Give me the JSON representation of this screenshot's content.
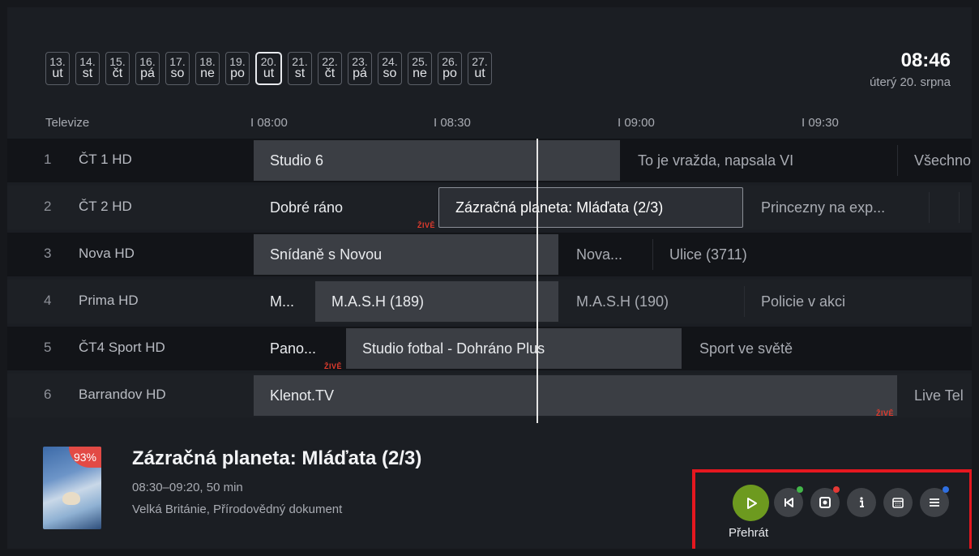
{
  "dates": [
    {
      "num": "13.",
      "day": "ut"
    },
    {
      "num": "14.",
      "day": "st"
    },
    {
      "num": "15.",
      "day": "čt"
    },
    {
      "num": "16.",
      "day": "pá"
    },
    {
      "num": "17.",
      "day": "so"
    },
    {
      "num": "18.",
      "day": "ne"
    },
    {
      "num": "19.",
      "day": "po"
    },
    {
      "num": "20.",
      "day": "ut"
    },
    {
      "num": "21.",
      "day": "st"
    },
    {
      "num": "22.",
      "day": "čt"
    },
    {
      "num": "23.",
      "day": "pá"
    },
    {
      "num": "24.",
      "day": "so"
    },
    {
      "num": "25.",
      "day": "ne"
    },
    {
      "num": "26.",
      "day": "po"
    },
    {
      "num": "27.",
      "day": "ut"
    }
  ],
  "selected_date_index": 7,
  "clock": {
    "time": "08:46",
    "date": "úterý 20. srpna"
  },
  "timeline": {
    "label": "Televize",
    "ticks": [
      "I 08:00",
      "I 08:30",
      "I 09:00",
      "I 09:30"
    ]
  },
  "live_label": "ŽIVĚ",
  "channels": [
    {
      "num": "1",
      "name": "ČT 1 HD",
      "programs": [
        "Studio 6",
        "To je vražda, napsala VI",
        "Všechno"
      ]
    },
    {
      "num": "2",
      "name": "ČT 2 HD",
      "programs": [
        "Dobré ráno",
        "Zázračná planeta: Mláďata (2/3)",
        "Princezny na exp...",
        ""
      ]
    },
    {
      "num": "3",
      "name": "Nova HD",
      "programs": [
        "Snídaně s Novou",
        "Nova...",
        "Ulice (3711)"
      ]
    },
    {
      "num": "4",
      "name": "Prima HD",
      "programs": [
        "M...",
        "M.A.S.H (189)",
        "M.A.S.H (190)",
        "Policie v akci"
      ]
    },
    {
      "num": "5",
      "name": "ČT4 Sport HD",
      "programs": [
        "Pano...",
        "Studio fotbal - Dohráno Plus",
        "Sport ve světě"
      ]
    },
    {
      "num": "6",
      "name": "Barrandov HD",
      "programs": [
        "Klenot.TV",
        "Live Tel"
      ]
    }
  ],
  "detail": {
    "title": "Zázračná planeta: Mláďata (2/3)",
    "time": "08:30–09:20, 50 min",
    "genre": "Velká Británie, Přírodovědný dokument",
    "progress": "93%"
  },
  "actions": {
    "play_label": "Přehrát"
  },
  "colors": {
    "accent_green": "#6d9a1f",
    "live_red": "#e33b2d",
    "highlight_red": "#e5171f",
    "dot_green": "#43b649",
    "dot_red": "#e53935",
    "dot_blue": "#2f6fe0"
  }
}
